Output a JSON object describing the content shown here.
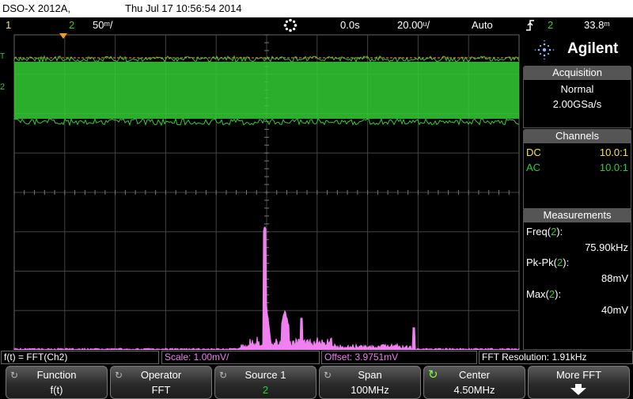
{
  "title_bar": {
    "model": "DSO-X 2012A,",
    "datetime": "Thu Jul 17 10:56:54 2014"
  },
  "status": {
    "ch1": "1",
    "ch2": "2",
    "ch2_scale": "50ᵐ/",
    "acq_icon": "acquisition-run-icon",
    "delay": "0.0s",
    "timebase": "20.00ᵘ/",
    "trigger_mode": "Auto",
    "trigger_source": "2",
    "trigger_level": "33.8ᵐ"
  },
  "colors": {
    "ch1": "#f4e642",
    "ch2": "#33cc33",
    "math": "#f080f0",
    "trigger": "#f09a30"
  },
  "panel": {
    "brand": "Agilent",
    "acquisition": {
      "title": "Acquisition",
      "mode": "Normal",
      "rate": "2.00GSa/s"
    },
    "channels": {
      "title": "Channels",
      "rows": [
        {
          "coupling": "DC",
          "probe": "10.0:1"
        },
        {
          "coupling": "AC",
          "probe": "10.0:1"
        }
      ]
    },
    "measurements": {
      "title": "Measurements",
      "items": [
        {
          "label": "Freq(2):",
          "value": "75.90kHz"
        },
        {
          "label": "Pk-Pk(2):",
          "value": "88mV"
        },
        {
          "label": "Max(2):",
          "value": "40mV"
        }
      ]
    }
  },
  "markers": {
    "trigger_marker": "T",
    "ch2_marker": "2"
  },
  "results": {
    "function": "f(t) = FFT(Ch2)",
    "scale": "Scale: 1.00mV/",
    "offset": "Offset: 3.9751mV",
    "resolution": "FFT Resolution: 1.91kHz"
  },
  "softkeys": [
    {
      "label": "Function",
      "value": "f(t)"
    },
    {
      "label": "Operator",
      "value": "FFT"
    },
    {
      "label": "Source 1",
      "value": "2"
    },
    {
      "label": "Span",
      "value": "100MHz"
    },
    {
      "label": "Center",
      "value": "4.50MHz"
    },
    {
      "label": "More FFT",
      "value": ""
    }
  ]
}
